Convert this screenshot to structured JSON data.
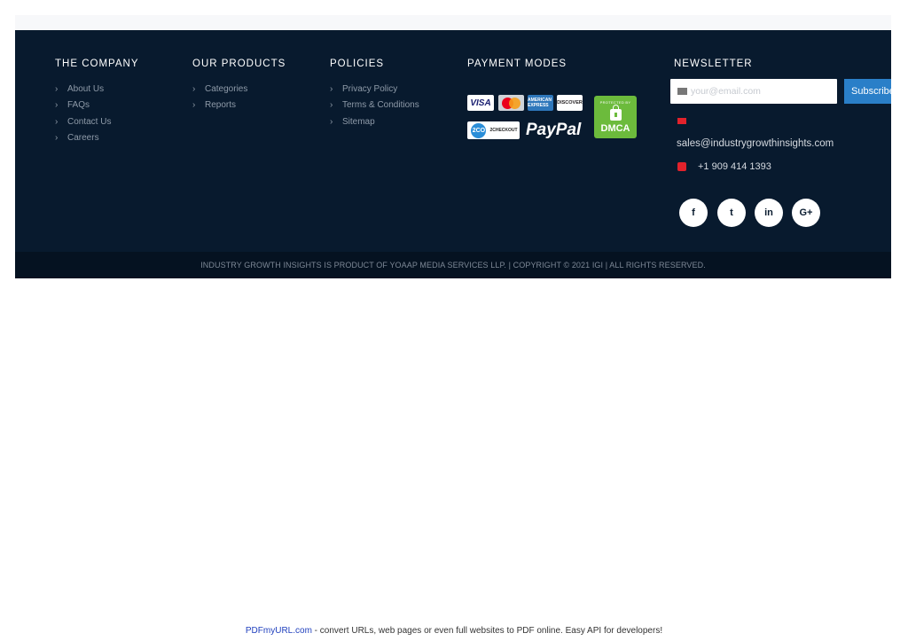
{
  "columns": {
    "company": {
      "title": "THE COMPANY",
      "items": [
        "About Us",
        "FAQs",
        "Contact Us",
        "Careers"
      ]
    },
    "products": {
      "title": "OUR PRODUCTS",
      "items": [
        "Categories",
        "Reports"
      ]
    },
    "policies": {
      "title": "POLICIES",
      "items": [
        "Privacy Policy",
        "Terms & Conditions",
        "Sitemap"
      ]
    },
    "payment": {
      "title": "PAYMENT MODES",
      "logos": {
        "visa": "VISA",
        "amex": "AMERICAN EXPRESS",
        "discover": "DISCOVER",
        "twoco": "2CO",
        "twoco_text": "2CHECKOUT",
        "paypal": "PayPal",
        "dmca_top": "PROTECTED BY",
        "dmca": "DMCA"
      }
    },
    "newsletter": {
      "title": "NEWSLETTER",
      "email_placeholder": "your@email.com",
      "subscribe_label": "Subscribe",
      "sales_email": "sales@industrygrowthinsights.com",
      "phone": "+1 909 414 1393",
      "social": [
        "f",
        "t",
        "in",
        "G+"
      ]
    }
  },
  "chevron": "›",
  "copyright": "INDUSTRY GROWTH INSIGHTS IS PRODUCT OF YOAAP MEDIA SERVICES LLP. | COPYRIGHT © 2021 IGI | ALL RIGHTS RESERVED.",
  "pdf_footer": {
    "link": "PDFmyURL.com",
    "text": " - convert URLs, web pages or even full websites to PDF online. Easy API for developers!"
  },
  "colors": {
    "footer_bg": "#081a2e",
    "bottom_bar_bg": "#051221",
    "accent_blue": "#2a7fc8",
    "icon_red": "#e2222b",
    "dmca_green": "#6cbb3c"
  }
}
